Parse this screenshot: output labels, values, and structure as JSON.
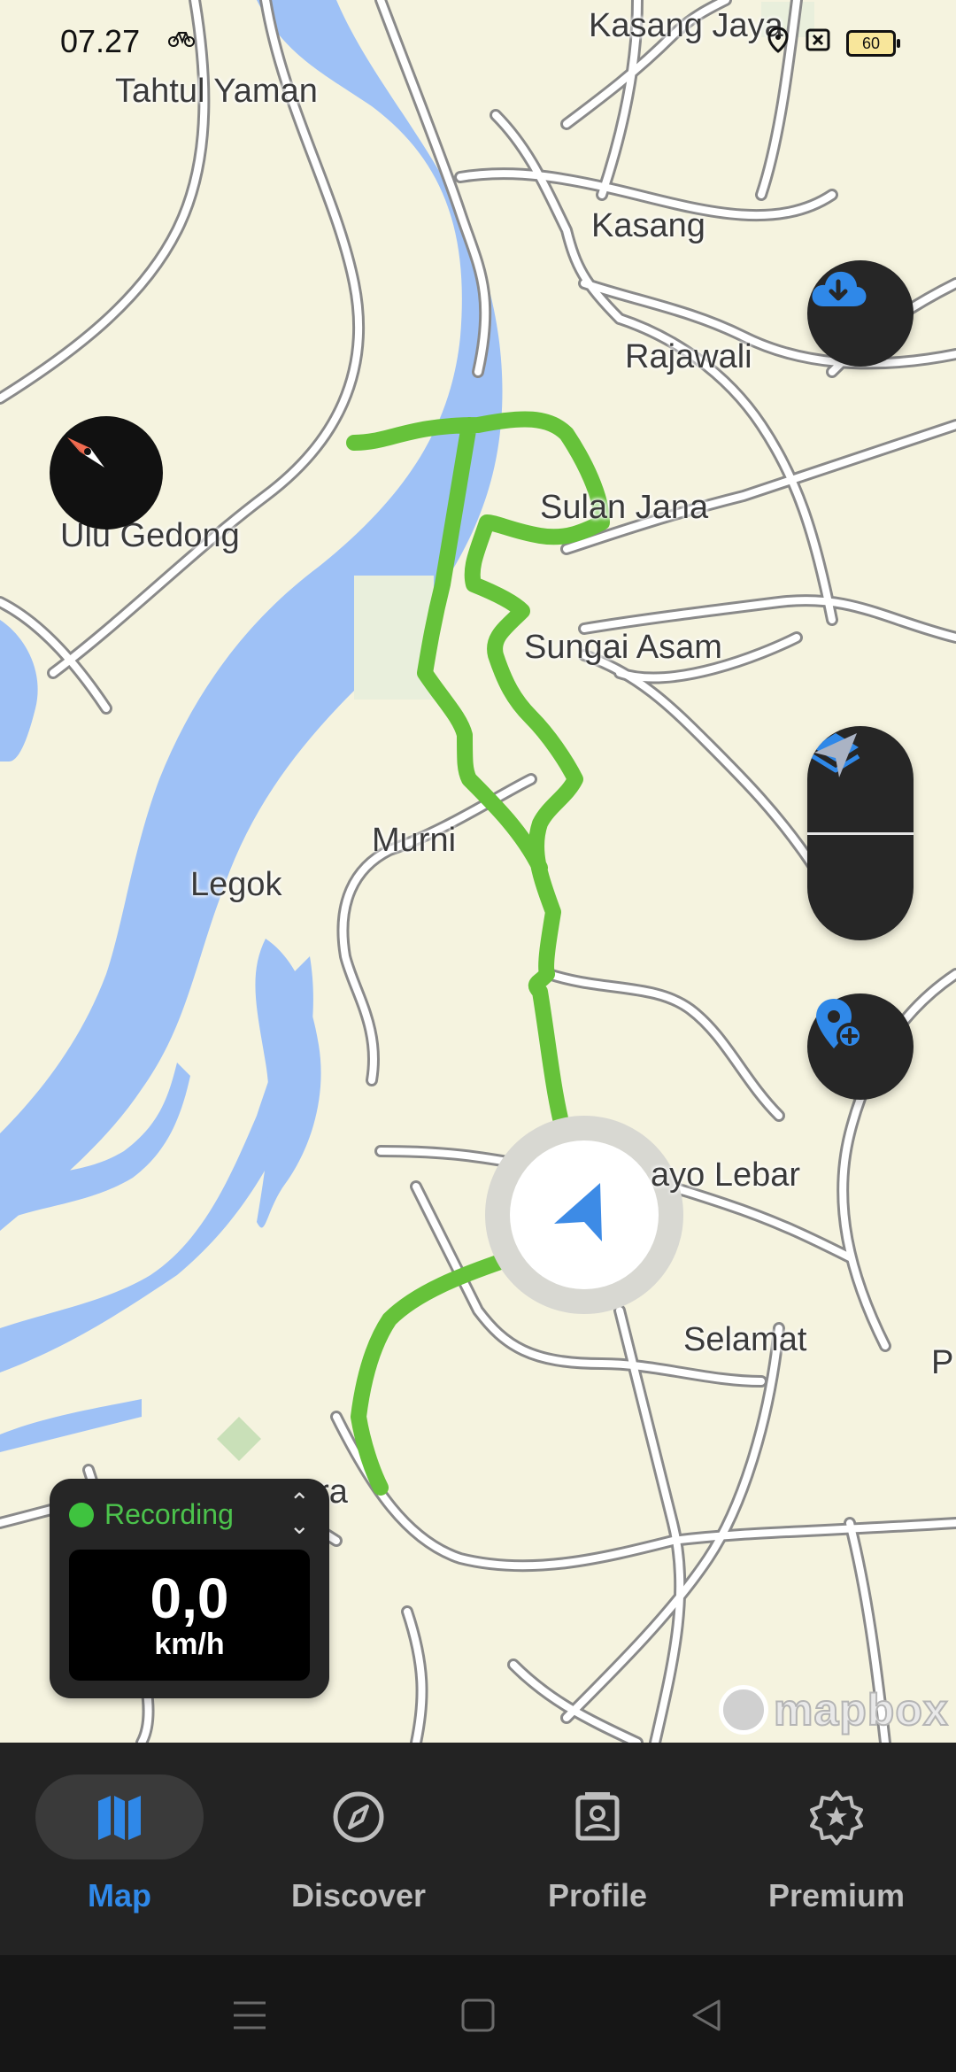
{
  "status_bar": {
    "time": "07.27",
    "battery_level": "60",
    "icons": [
      "bike-icon",
      "location-pin-icon",
      "x-box-icon",
      "battery-icon"
    ]
  },
  "map": {
    "places": [
      {
        "name": "Kasang Jaya"
      },
      {
        "name": "Tahtul Yaman"
      },
      {
        "name": "Kasang"
      },
      {
        "name": "Rajawali"
      },
      {
        "name": "Ulu Gedong"
      },
      {
        "name": "Sulan Jana"
      },
      {
        "name": "Sungai Asam"
      },
      {
        "name": "Murni"
      },
      {
        "name": "Legok"
      },
      {
        "name": "ayo Lebar"
      },
      {
        "name": "Selamat"
      },
      {
        "name": "P"
      },
      {
        "name": "ura"
      }
    ],
    "attribution": "mapbox",
    "colors": {
      "land": "#f5f3df",
      "water": "#9ec1f6",
      "road": "#ffffff",
      "road_casing": "#8a8a8a",
      "track": "#66c23a",
      "accent": "#2f88e8"
    }
  },
  "controls": {
    "download_icon": "cloud-download-icon",
    "layers_icon": "layers-icon",
    "locate_icon": "navigation-arrow-icon",
    "add_poi_icon": "add-location-pin-icon",
    "compass_icon": "compass-needle-icon"
  },
  "recording": {
    "status": "Recording",
    "speed": "0,0",
    "unit": "km/h"
  },
  "bottom_nav": {
    "items": [
      {
        "label": "Map",
        "icon": "map-icon",
        "active": true
      },
      {
        "label": "Discover",
        "icon": "compass-icon",
        "active": false
      },
      {
        "label": "Profile",
        "icon": "profile-card-icon",
        "active": false
      },
      {
        "label": "Premium",
        "icon": "premium-badge-icon",
        "active": false
      }
    ]
  },
  "system_nav": [
    "menu-icon",
    "home-icon",
    "back-icon"
  ]
}
